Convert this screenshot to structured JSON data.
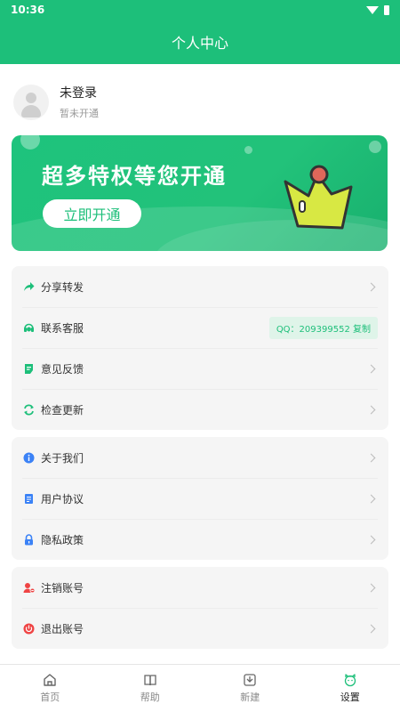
{
  "status": {
    "time": "10:36"
  },
  "title": "个人中心",
  "user": {
    "name": "未登录",
    "sub": "暂未开通"
  },
  "banner": {
    "title": "超多特权等您开通",
    "button": "立即开通"
  },
  "menu": {
    "group1": [
      {
        "label": "分享转发",
        "icon": "share-icon"
      },
      {
        "label": "联系客服",
        "icon": "customer-service-icon",
        "badge": "QQ：209399552 复制"
      },
      {
        "label": "意见反馈",
        "icon": "feedback-icon"
      },
      {
        "label": "检查更新",
        "icon": "refresh-icon"
      }
    ],
    "group2": [
      {
        "label": "关于我们",
        "icon": "info-icon"
      },
      {
        "label": "用户协议",
        "icon": "document-icon"
      },
      {
        "label": "隐私政策",
        "icon": "lock-icon"
      }
    ],
    "group3": [
      {
        "label": "注销账号",
        "icon": "user-delete-icon"
      },
      {
        "label": "退出账号",
        "icon": "power-icon"
      }
    ]
  },
  "tabs": [
    {
      "label": "首页",
      "icon": "home-icon"
    },
    {
      "label": "帮助",
      "icon": "book-icon"
    },
    {
      "label": "新建",
      "icon": "inbox-icon"
    },
    {
      "label": "设置",
      "icon": "settings-face-icon",
      "active": true
    }
  ],
  "colors": {
    "brand": "#1dbf7a",
    "card_bg": "#f5f5f5"
  }
}
